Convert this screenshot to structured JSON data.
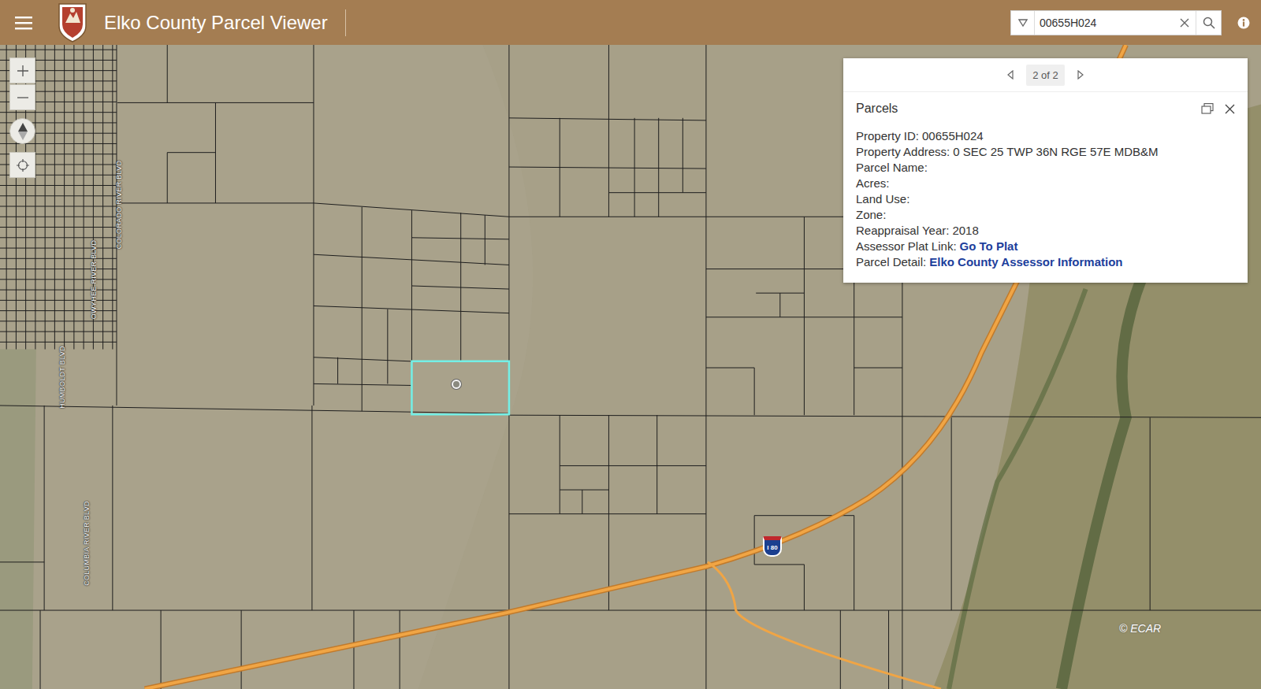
{
  "header": {
    "title": "Elko County Parcel Viewer"
  },
  "search": {
    "value": "00655H024"
  },
  "popup": {
    "pager": "2 of 2",
    "title": "Parcels",
    "fields": [
      {
        "label": "Property ID:",
        "value": "00655H024",
        "kind": "text"
      },
      {
        "label": "Property Address:",
        "value": "0 SEC 25 TWP 36N RGE 57E MDB&M",
        "kind": "text"
      },
      {
        "label": "Parcel Name:",
        "value": "",
        "kind": "text"
      },
      {
        "label": "Acres:",
        "value": "",
        "kind": "text"
      },
      {
        "label": "Land Use:",
        "value": "",
        "kind": "text"
      },
      {
        "label": "Zone:",
        "value": "",
        "kind": "text"
      },
      {
        "label": "Reappraisal Year:",
        "value": "2018",
        "kind": "text"
      },
      {
        "label": "Assessor Plat Link:",
        "value": "Go To Plat",
        "kind": "link"
      },
      {
        "label": "Parcel Detail:",
        "value": "Elko County Assessor Information",
        "kind": "link"
      }
    ]
  },
  "map": {
    "street_labels": [
      "COLORADO RIVER BLVD",
      "OWYHEE RIVER BLVD",
      "HUMBOLDT BLVD",
      "COLUMBIA RIVER BLVD"
    ],
    "shield": "I 80",
    "attribution": "© ECAR"
  }
}
